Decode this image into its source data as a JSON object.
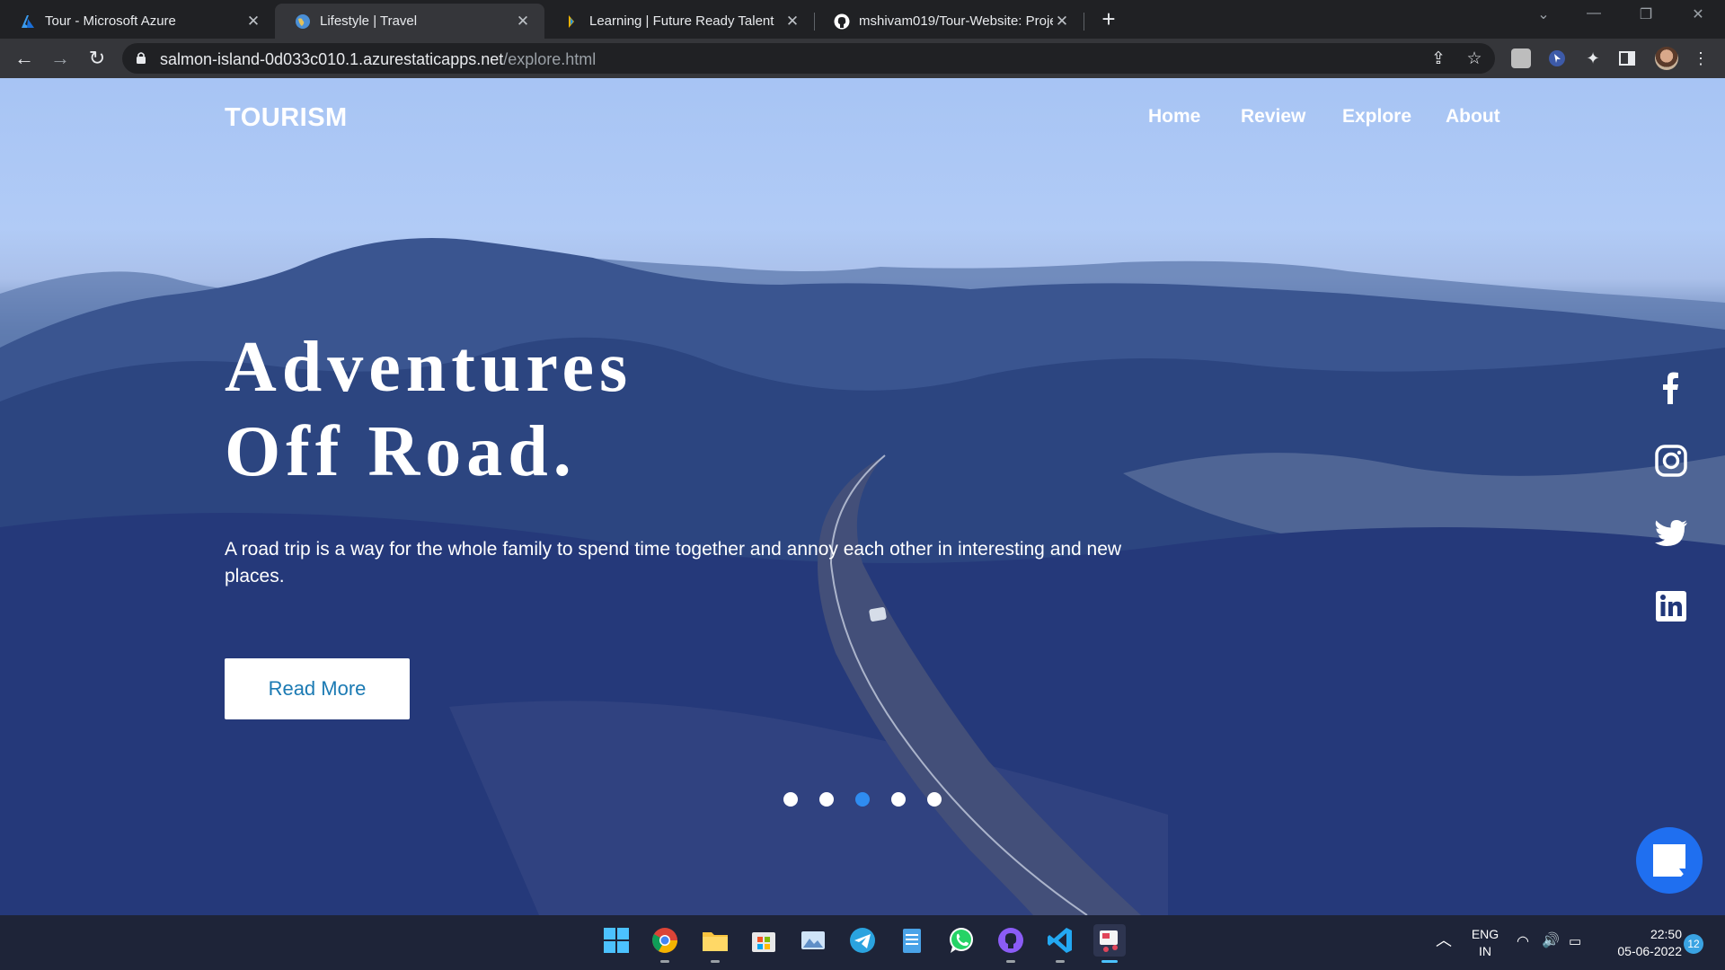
{
  "browser": {
    "tabs": [
      {
        "title": "Tour - Microsoft Azure",
        "active": false
      },
      {
        "title": "Lifestyle | Travel",
        "active": true
      },
      {
        "title": "Learning | Future Ready Talent",
        "active": false
      },
      {
        "title": "mshivam019/Tour-Website: Proje",
        "active": false
      }
    ],
    "url_host": "salmon-island-0d033c010.1.azurestaticapps.net",
    "url_path": "/explore.html"
  },
  "site": {
    "brand": "TOURISM",
    "nav": [
      "Home",
      "Review",
      "Explore",
      "About"
    ],
    "headline_line1": "Adventures",
    "headline_line2": "Off Road.",
    "tagline": "A road trip is a way for the whole family to spend time together and annoy each other in interesting and new places.",
    "cta_label": "Read More",
    "slider": {
      "count": 5,
      "active_index": 2
    },
    "social": [
      "facebook-icon",
      "instagram-icon",
      "twitter-icon",
      "linkedin-icon"
    ],
    "accent_color": "#1b7ab3"
  },
  "taskbar": {
    "apps": [
      "windows-start-icon",
      "chrome-icon",
      "file-explorer-icon",
      "microsoft-store-icon",
      "photos-icon",
      "telegram-icon",
      "notepad-icon",
      "whatsapp-icon",
      "github-desktop-icon",
      "vscode-icon",
      "snipping-tool-icon"
    ],
    "language": "ENG",
    "region": "IN",
    "time": "22:50",
    "date": "05-06-2022",
    "notification_count": "12"
  }
}
